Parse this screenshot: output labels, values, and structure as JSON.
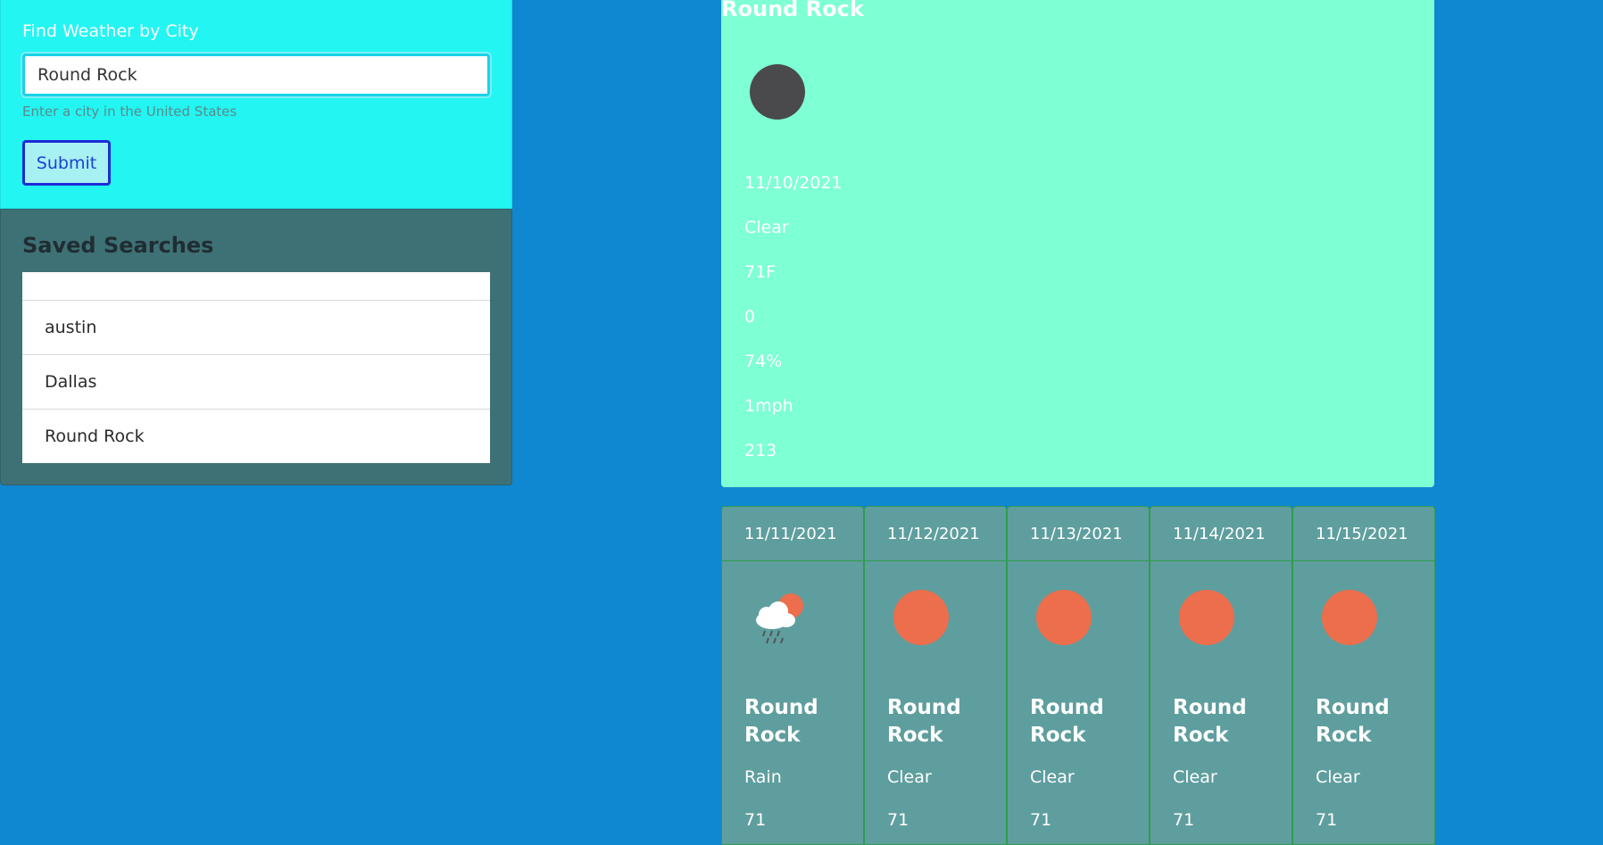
{
  "search": {
    "label": "Find Weather by City",
    "value": "Round Rock",
    "hint": "Enter a city in the United States",
    "submit_label": "Submit"
  },
  "saved": {
    "title": "Saved Searches",
    "items": [
      "",
      "austin",
      "Dallas",
      "Round Rock"
    ]
  },
  "current": {
    "city": "Round Rock",
    "icon": "night-clear-icon",
    "date": "11/10/2021",
    "condition": "Clear",
    "temp": "71F",
    "value_a": "0",
    "humidity": "74%",
    "wind": "1mph",
    "value_b": "213"
  },
  "forecast": [
    {
      "date": "11/11/2021",
      "icon": "rain-cloud-icon",
      "city": "Round Rock",
      "condition": "Rain",
      "temp": "71"
    },
    {
      "date": "11/12/2021",
      "icon": "sun-icon",
      "city": "Round Rock",
      "condition": "Clear",
      "temp": "71"
    },
    {
      "date": "11/13/2021",
      "icon": "sun-icon",
      "city": "Round Rock",
      "condition": "Clear",
      "temp": "71"
    },
    {
      "date": "11/14/2021",
      "icon": "sun-icon",
      "city": "Round Rock",
      "condition": "Clear",
      "temp": "71"
    },
    {
      "date": "11/15/2021",
      "icon": "sun-icon",
      "city": "Round Rock",
      "condition": "Clear",
      "temp": "71"
    }
  ],
  "colors": {
    "background": "#0f87d1",
    "search_panel": "#22f5f2",
    "saved_panel": "#3e7176",
    "current_card": "#7effd4",
    "forecast_card": "#5f9e9e",
    "sun": "#ec6e4c"
  }
}
